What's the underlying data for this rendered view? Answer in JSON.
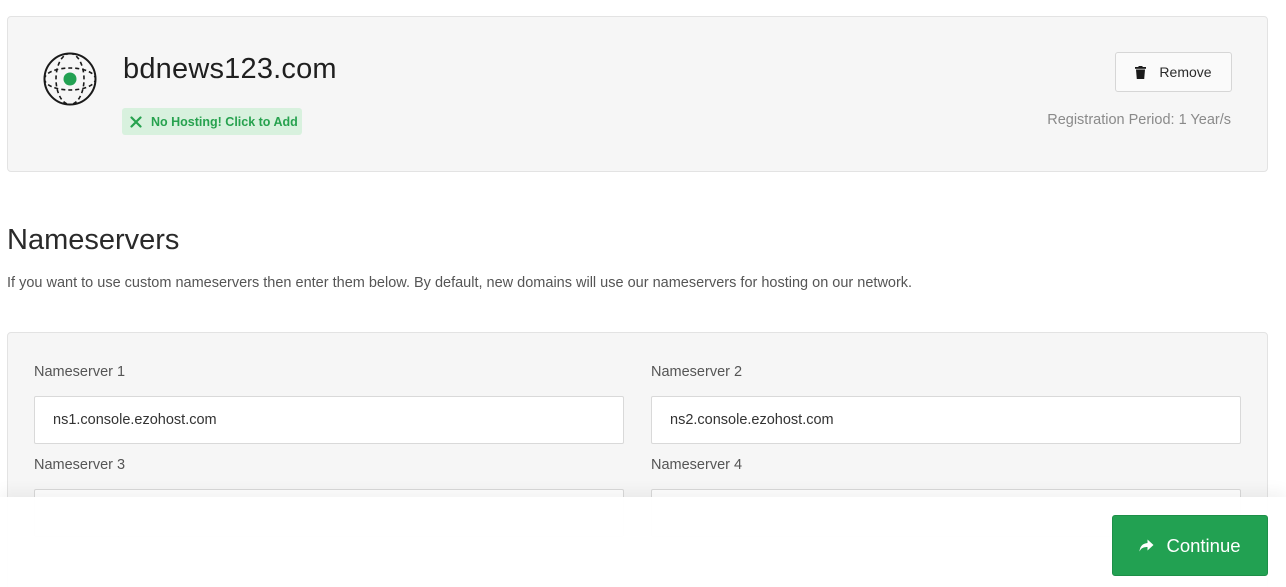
{
  "domain": {
    "name": "bdnews123.com",
    "hosting_badge": "No Hosting! Click to Add",
    "remove_label": "Remove",
    "registration_period": "Registration Period: 1 Year/s",
    "icon": "globe-icon"
  },
  "nameservers": {
    "title": "Nameservers",
    "description": "If you want to use custom nameservers then enter them below. By default, new domains will use our nameservers for hosting on our network.",
    "fields": [
      {
        "label": "Nameserver 1",
        "value": "ns1.console.ezohost.com"
      },
      {
        "label": "Nameserver 2",
        "value": "ns2.console.ezohost.com"
      },
      {
        "label": "Nameserver 3",
        "value": ""
      },
      {
        "label": "Nameserver 4",
        "value": ""
      }
    ]
  },
  "footer": {
    "continue_label": "Continue"
  },
  "colors": {
    "accent_green": "#22a152",
    "badge_bg": "#d8f1de",
    "card_bg": "#f6f6f6"
  }
}
